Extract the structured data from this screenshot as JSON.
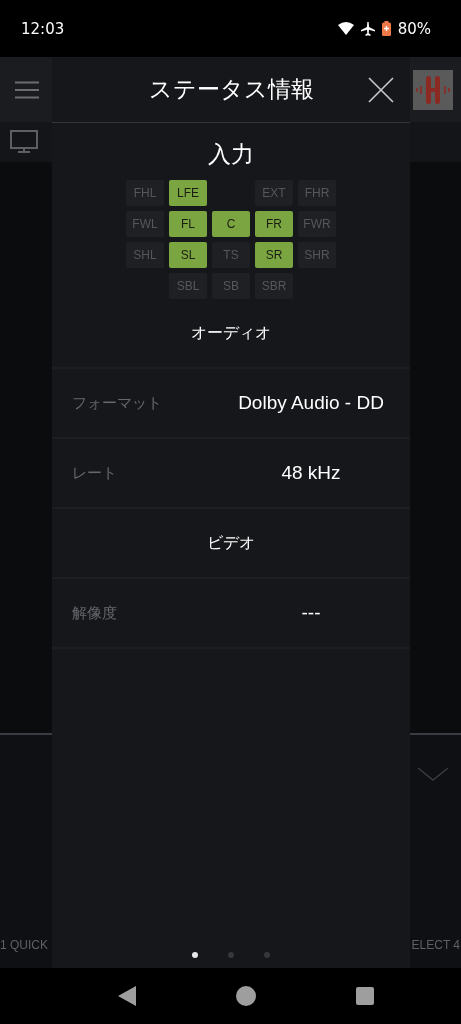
{
  "status_bar": {
    "time": "12:03",
    "battery": "80%"
  },
  "background": {
    "bottom_left": "1 QUICK",
    "bottom_right": "ELECT 4"
  },
  "dialog": {
    "title": "ステータス情報",
    "input_heading": "入力",
    "channels": [
      [
        {
          "kind": "channel",
          "label": "FHL",
          "on": false
        },
        {
          "kind": "channel",
          "label": "LFE",
          "on": true
        },
        {
          "kind": "gap"
        },
        {
          "kind": "channel",
          "label": "EXT",
          "on": false
        },
        {
          "kind": "channel",
          "label": "FHR",
          "on": false
        }
      ],
      [
        {
          "kind": "channel",
          "label": "FWL",
          "on": false
        },
        {
          "kind": "channel",
          "label": "FL",
          "on": true
        },
        {
          "kind": "channel",
          "label": "C",
          "on": true
        },
        {
          "kind": "channel",
          "label": "FR",
          "on": true
        },
        {
          "kind": "channel",
          "label": "FWR",
          "on": false
        }
      ],
      [
        {
          "kind": "channel",
          "label": "SHL",
          "on": false
        },
        {
          "kind": "channel",
          "label": "SL",
          "on": true
        },
        {
          "kind": "channel",
          "label": "TS",
          "on": false
        },
        {
          "kind": "channel",
          "label": "SR",
          "on": true
        },
        {
          "kind": "channel",
          "label": "SHR",
          "on": false
        }
      ],
      [
        {
          "kind": "gap"
        },
        {
          "kind": "channel",
          "label": "SBL",
          "on": false
        },
        {
          "kind": "channel",
          "label": "SB",
          "on": false
        },
        {
          "kind": "channel",
          "label": "SBR",
          "on": false
        },
        {
          "kind": "gap"
        }
      ]
    ],
    "sections": [
      {
        "kind": "heading",
        "text": "オーディオ"
      },
      {
        "kind": "row",
        "label": "フォーマット",
        "value": "Dolby Audio - DD"
      },
      {
        "kind": "row",
        "label": "レート",
        "value": "48 kHz"
      },
      {
        "kind": "heading",
        "text": "ビデオ"
      },
      {
        "kind": "row",
        "label": "解像度",
        "value": "---"
      }
    ],
    "pages": [
      {
        "selected": true
      },
      {
        "selected": false
      },
      {
        "selected": false
      }
    ]
  }
}
